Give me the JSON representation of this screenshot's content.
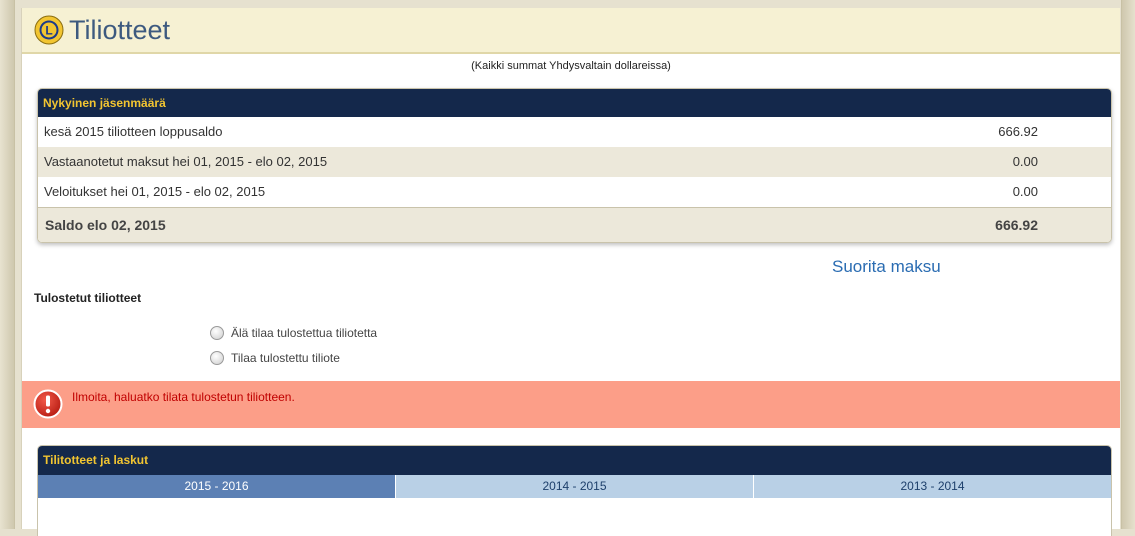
{
  "header": {
    "title": "Tiliotteet",
    "logo_icon": "lions-club-logo"
  },
  "currency_note": "(Kaikki summat Yhdysvaltain dollareissa)",
  "membership": {
    "heading": "Nykyinen jäsenmäärä",
    "rows": [
      {
        "label": "kesä 2015 tiliotteen loppusaldo",
        "amount": "666.92"
      },
      {
        "label": "Vastaanotetut maksut hei 01, 2015 - elo 02, 2015",
        "amount": "0.00"
      },
      {
        "label": "Veloitukset hei 01, 2015 - elo 02, 2015",
        "amount": "0.00"
      }
    ],
    "total": {
      "label": "Saldo elo 02, 2015",
      "amount": "666.92"
    }
  },
  "pay_link": "Suorita maksu",
  "printed": {
    "heading": "Tulostetut tiliotteet",
    "options": [
      {
        "label": "Älä tilaa tulostettua tiliotetta",
        "selected": false
      },
      {
        "label": "Tilaa tulostettu tiliote",
        "selected": false
      }
    ]
  },
  "error": {
    "message": "Ilmoita, haluatko tilata tulostetun tiliotteen.",
    "icon": "exclamation-icon",
    "color": "#c00000",
    "background": "#fc9e88"
  },
  "statements": {
    "heading": "Tilitotteet ja laskut",
    "tabs": [
      {
        "label": "2015 - 2016",
        "active": true
      },
      {
        "label": "2014 - 2015",
        "active": false
      },
      {
        "label": "2013 - 2014",
        "active": false
      }
    ]
  },
  "colors": {
    "navy": "#14284b",
    "gold": "#f2c531",
    "link": "#2a6cb2",
    "tab_active": "#5c80b4",
    "tab_inactive": "#b9d0e6"
  }
}
